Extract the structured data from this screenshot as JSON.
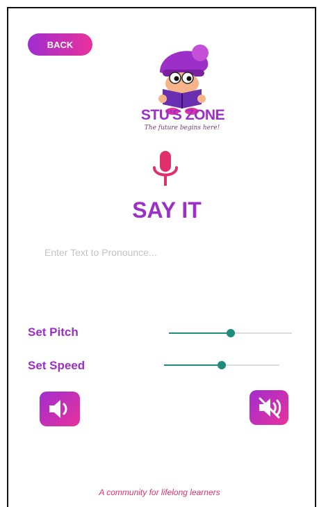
{
  "header": {
    "back_label": "BACK"
  },
  "brand": {
    "name": "STU'S ZONE",
    "tagline": "The future begins here!"
  },
  "page": {
    "title": "SAY IT"
  },
  "input": {
    "placeholder": "Enter Text to Pronounce...",
    "value": ""
  },
  "controls": {
    "pitch": {
      "label": "Set Pitch",
      "level": 0.5
    },
    "speed": {
      "label": "Set Speed",
      "level": 0.5
    }
  },
  "buttons": {
    "speak_icon": "speaker-icon",
    "mute_icon": "mute-icon"
  },
  "footer": {
    "text": "A community for lifelong learners"
  },
  "colors": {
    "accent": "#9b2fc7",
    "pink": "#e8329b",
    "teal": "#1f8b7a",
    "mic": "#e0306a"
  }
}
